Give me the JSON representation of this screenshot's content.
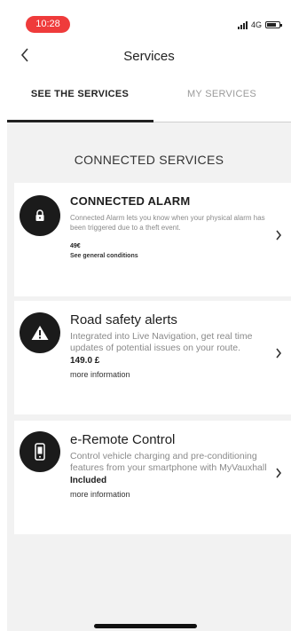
{
  "status_bar": {
    "time": "10:28",
    "network": "4G"
  },
  "header": {
    "back_icon": "chevron-left-icon",
    "title": "Services"
  },
  "tabs": [
    {
      "label": "SEE THE SERVICES",
      "active": true
    },
    {
      "label": "MY SERVICES",
      "active": false
    }
  ],
  "section_title": "CONNECTED SERVICES",
  "services": [
    {
      "icon": "lock-icon",
      "title": "CONNECTED ALARM",
      "description": "Connected Alarm lets you know when your physical alarm has been triggered due to a theft event.",
      "price": "49€",
      "link": "See general conditions"
    },
    {
      "icon": "warning-icon",
      "title": "Road safety alerts",
      "description": "Integrated into Live Navigation, get real time updates of potential issues on your route.",
      "price": "149.0 £",
      "link": "more information"
    },
    {
      "icon": "phone-icon",
      "title": "e-Remote Control",
      "description": "Control vehicle charging and pre-conditioning features from your smartphone with MyVauxhall",
      "price": "Included",
      "link": "more information"
    }
  ],
  "colors": {
    "time_pill": "#ef3b3b",
    "icon_background": "#1b1b1b",
    "page_background": "#f2f2f2"
  }
}
